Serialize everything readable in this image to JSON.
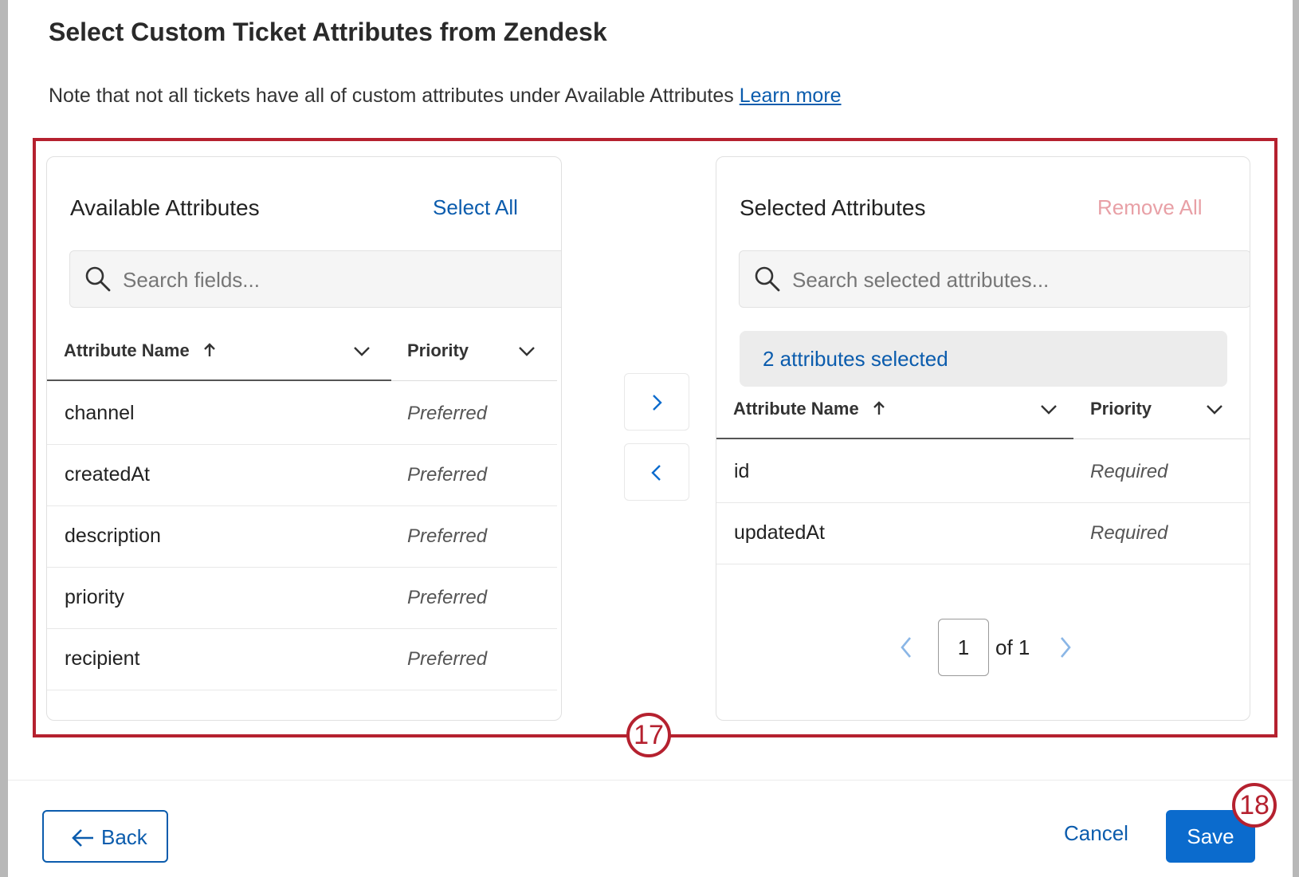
{
  "dialog": {
    "title": "Select Custom Ticket Attributes from Zendesk",
    "note": "Note that not all tickets have all of custom attributes under Available Attributes",
    "learn_more": "Learn more"
  },
  "available": {
    "title": "Available Attributes",
    "action": "Select All",
    "search_placeholder": "Search fields...",
    "col_name": "Attribute Name",
    "col_priority": "Priority",
    "rows": [
      {
        "name": "channel",
        "priority": "Preferred"
      },
      {
        "name": "createdAt",
        "priority": "Preferred"
      },
      {
        "name": "description",
        "priority": "Preferred"
      },
      {
        "name": "priority",
        "priority": "Preferred"
      },
      {
        "name": "recipient",
        "priority": "Preferred"
      }
    ]
  },
  "selected": {
    "title": "Selected Attributes",
    "action": "Remove All",
    "search_placeholder": "Search selected attributes...",
    "count_label": "2 attributes selected",
    "col_name": "Attribute Name",
    "col_priority": "Priority",
    "rows": [
      {
        "name": "id",
        "priority": "Required"
      },
      {
        "name": "updatedAt",
        "priority": "Required"
      }
    ],
    "pager": {
      "page": "1",
      "of_label": "of 1"
    }
  },
  "footer": {
    "back": "Back",
    "cancel": "Cancel",
    "save": "Save"
  },
  "callouts": {
    "c1": "17",
    "c2": "18"
  },
  "colors": {
    "accent": "#0b5cad",
    "primary_button": "#0b6bcd",
    "highlight": "#b5212f",
    "disabled_action": "#e8a0a6"
  }
}
